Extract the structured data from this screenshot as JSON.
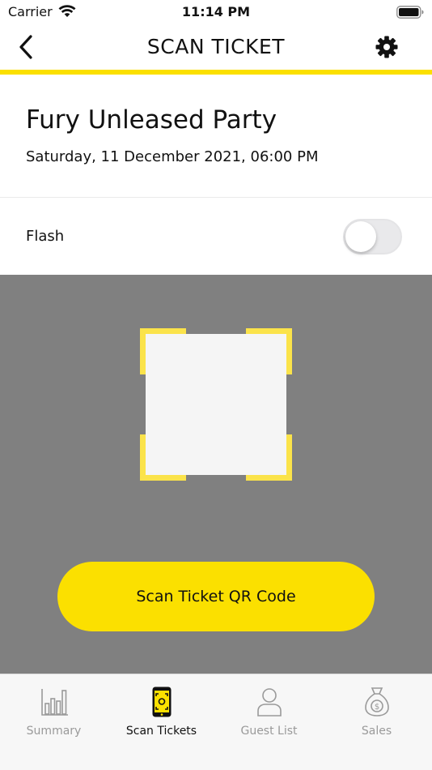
{
  "status_bar": {
    "carrier": "Carrier",
    "time": "11:14 PM"
  },
  "nav": {
    "title": "SCAN TICKET",
    "back_icon": "chevron-left-icon",
    "settings_icon": "gear-icon"
  },
  "event": {
    "title": "Fury Unleased Party",
    "date": "Saturday, 11 December 2021, 06:00 PM"
  },
  "flash": {
    "label": "Flash",
    "enabled": false
  },
  "scanner": {
    "button_label": "Scan Ticket QR Code"
  },
  "tabs": [
    {
      "label": "Summary",
      "icon": "bar-chart-icon",
      "active": false
    },
    {
      "label": "Scan Tickets",
      "icon": "phone-scan-icon",
      "active": true
    },
    {
      "label": "Guest List",
      "icon": "person-icon",
      "active": false
    },
    {
      "label": "Sales",
      "icon": "money-bag-icon",
      "active": false
    }
  ],
  "colors": {
    "accent": "#fbe000",
    "scan_background": "#808080",
    "inactive_tab": "#9a9a9a"
  }
}
